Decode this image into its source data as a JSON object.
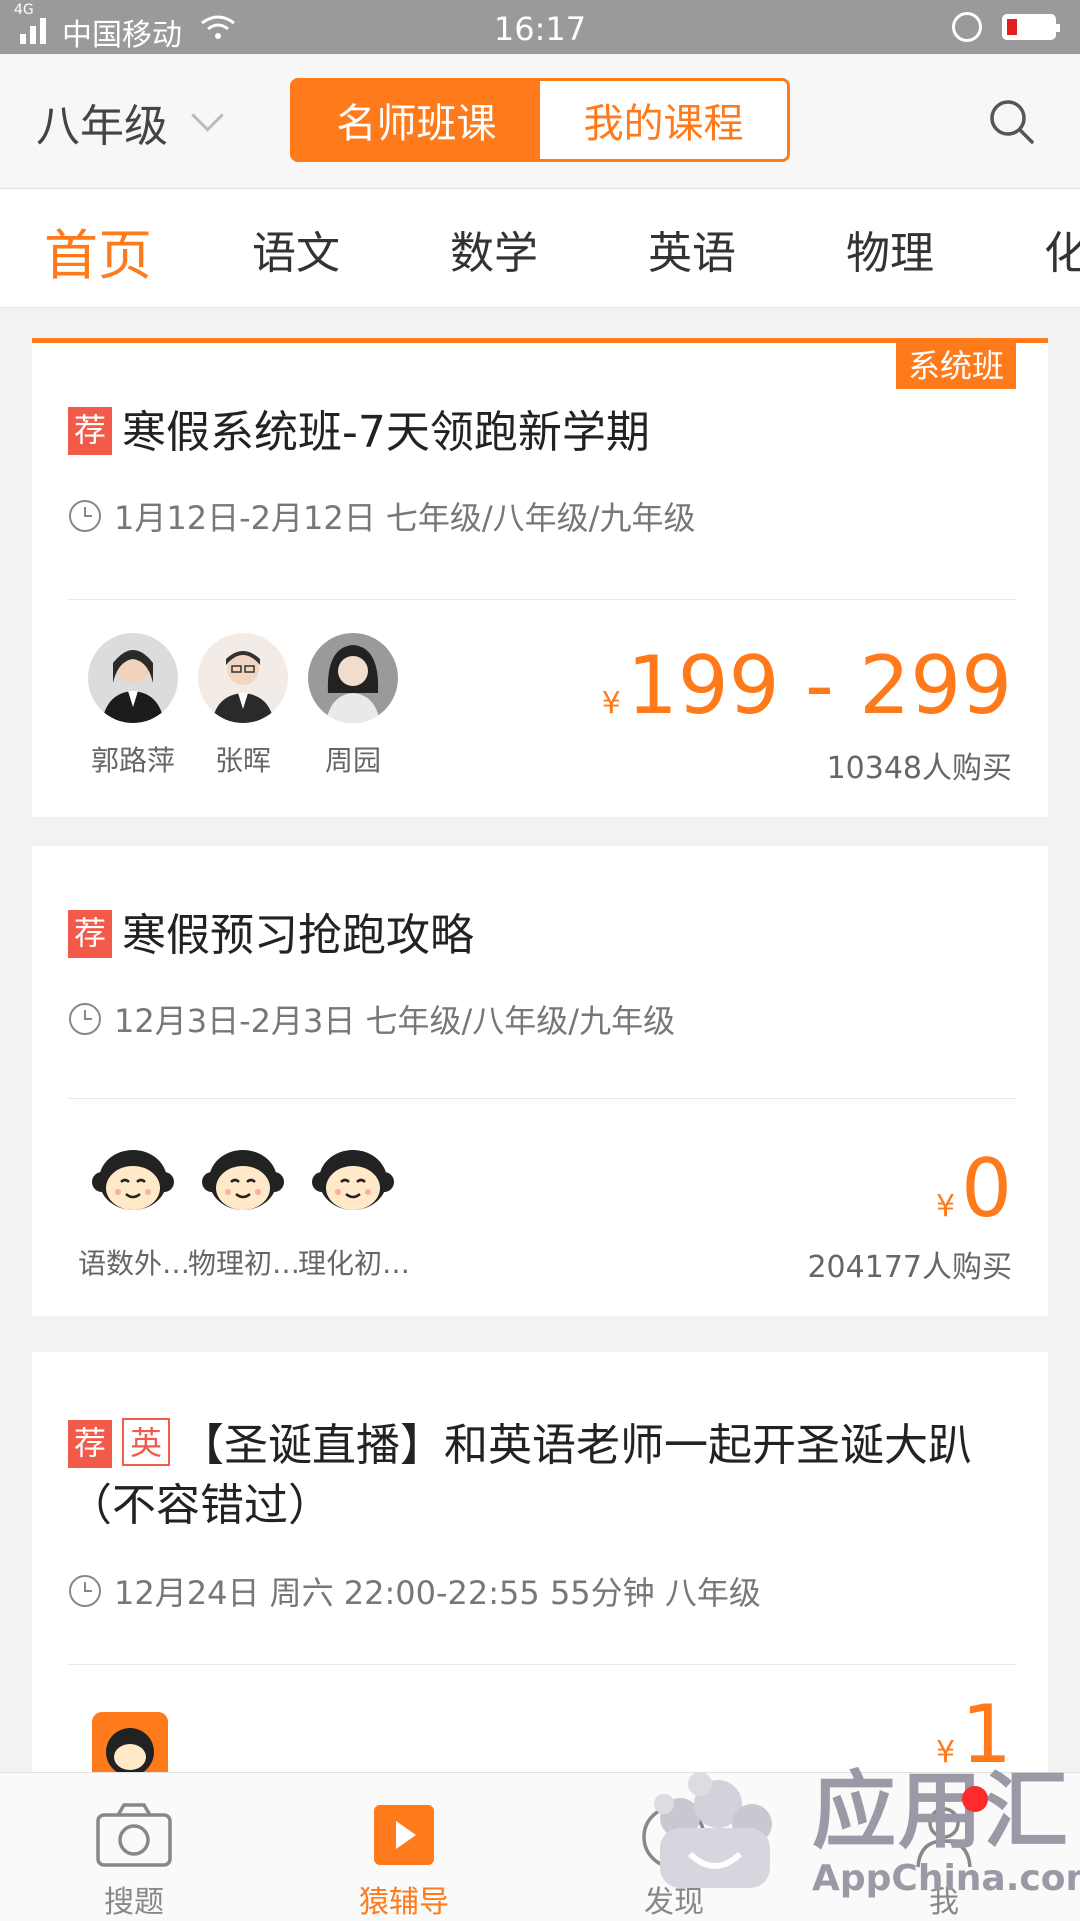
{
  "status_bar": {
    "network": "4G",
    "carrier": "中国移动",
    "time": "16:17"
  },
  "header": {
    "grade": "八年级",
    "segments": [
      "名师班课",
      "我的课程"
    ],
    "active_segment": "名师班课"
  },
  "tabs": {
    "items": [
      "首页",
      "语文",
      "数学",
      "英语",
      "物理",
      "化"
    ],
    "active": "首页"
  },
  "courses": [
    {
      "corner_tag": "系统班",
      "tags": [
        "荐"
      ],
      "title": "寒假系统班-7天领跑新学期",
      "meta": "1月12日-2月12日 七年级/八年级/九年级",
      "teachers": [
        "郭路萍",
        "张晖",
        "周园"
      ],
      "currency": "¥",
      "price": "199 - 299",
      "buyers": "10348人购买"
    },
    {
      "tags": [
        "荐"
      ],
      "title": "寒假预习抢跑攻略",
      "meta": "12月3日-2月3日 七年级/八年级/九年级",
      "teachers": [
        "语数外…",
        "物理初…",
        "理化初…"
      ],
      "currency": "¥",
      "price": "0",
      "buyers": "204177人购买"
    },
    {
      "tags": [
        "荐",
        "英"
      ],
      "title": "【圣诞直播】和英语老师一起开圣诞大趴（不容错过）",
      "meta": "12月24日 周六 22:00-22:55 55分钟 八年级",
      "currency": "¥",
      "price": "1"
    }
  ],
  "bottom_nav": {
    "items": [
      "搜题",
      "猿辅导",
      "发现",
      "我"
    ],
    "active": "猿辅导"
  },
  "watermark": {
    "text": "应用汇",
    "subtext": "AppChina.com"
  },
  "colors": {
    "accent": "#ff7a1a",
    "tag_red": "#f25a4a",
    "background": "#f2f2f2"
  }
}
